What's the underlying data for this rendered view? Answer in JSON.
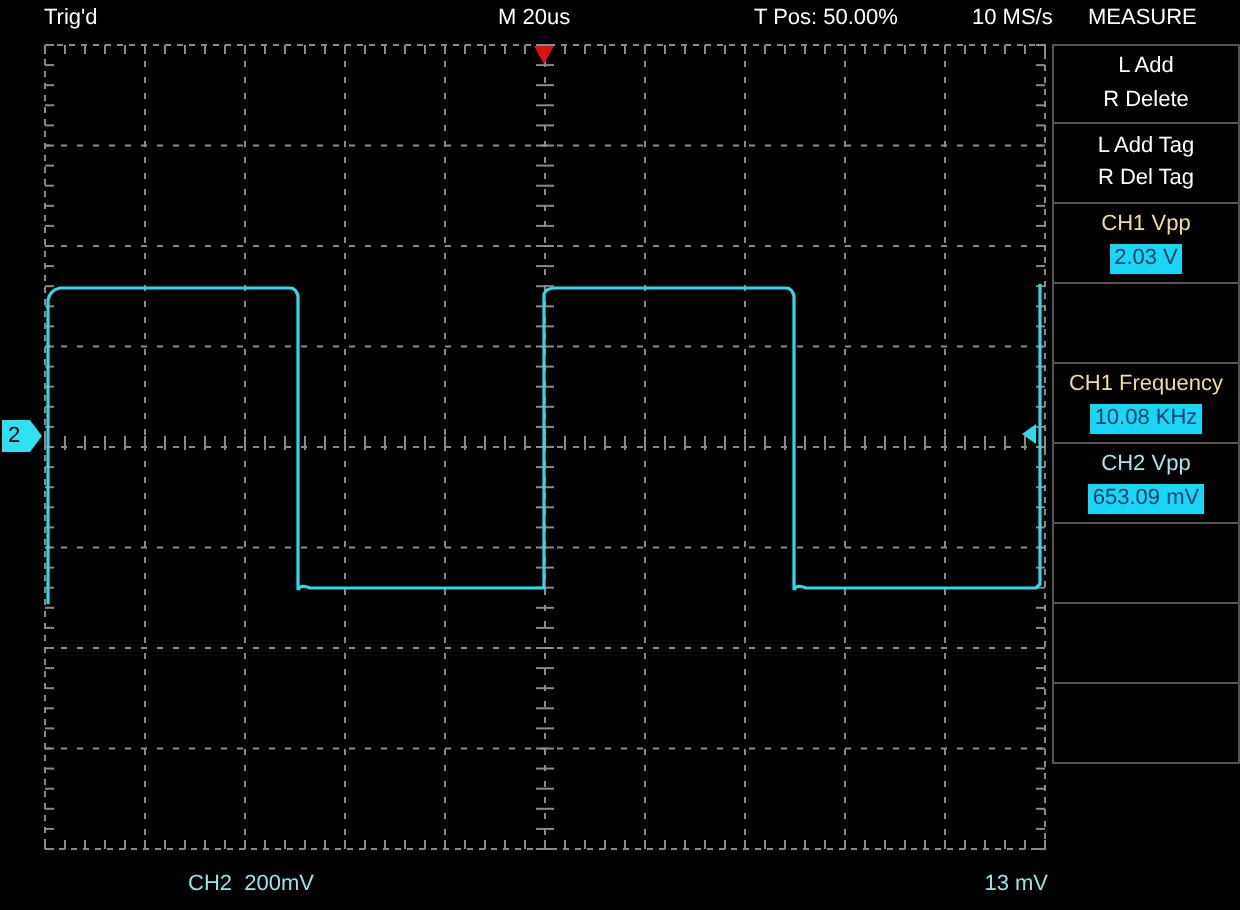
{
  "status_bar": {
    "trigger_state": "Trig'd",
    "timebase": "M 20us",
    "trigger_position": "T Pos: 50.00%",
    "sample_rate": "10 MS/s"
  },
  "menu": {
    "title": "MEASURE",
    "items": [
      {
        "kind": "action",
        "lines": [
          "L Add",
          "R Delete"
        ]
      },
      {
        "kind": "action",
        "lines": [
          "L Add Tag",
          "R Del Tag"
        ]
      },
      {
        "kind": "readout",
        "label": "CH1 Vpp",
        "value": "2.03 V",
        "color": "#f0dca0"
      },
      {
        "kind": "empty"
      },
      {
        "kind": "readout",
        "label": "CH1 Frequency",
        "value": "10.08 KHz",
        "color": "#f0dca0"
      },
      {
        "kind": "readout",
        "label": "CH2 Vpp",
        "value": "653.09 mV",
        "color": "#a8e4ec"
      },
      {
        "kind": "empty"
      },
      {
        "kind": "empty"
      },
      {
        "kind": "empty"
      }
    ]
  },
  "channel_marker": "2",
  "bottom_bar": {
    "channel_scale": "CH2  200mV",
    "trigger_level": "13 mV"
  }
}
